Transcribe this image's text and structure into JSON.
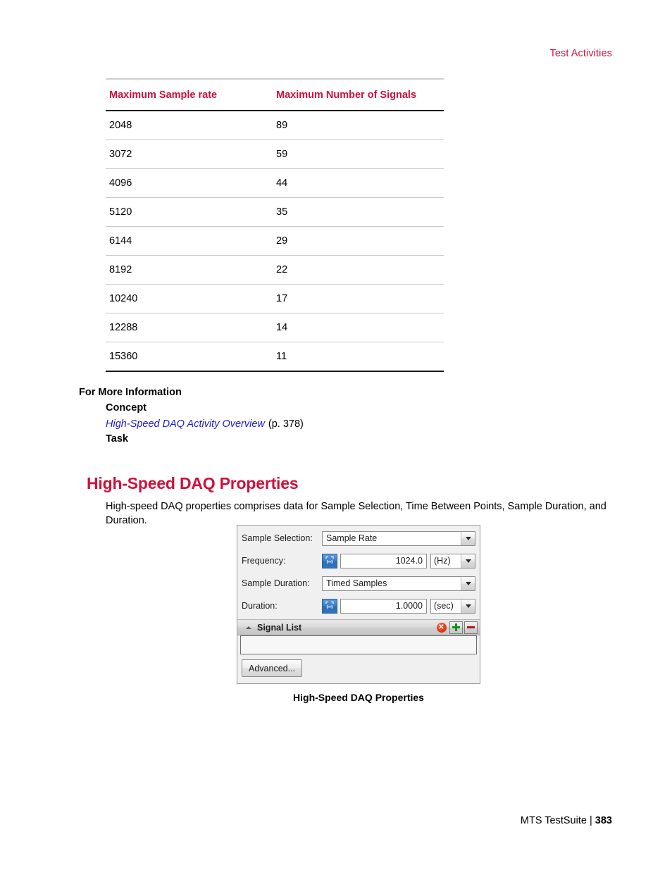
{
  "header": {
    "running_head": "Test Activities"
  },
  "spec_table": {
    "columns": [
      "Maximum Sample rate",
      "Maximum Number of Signals"
    ],
    "rows": [
      [
        "2048",
        "89"
      ],
      [
        "3072",
        "59"
      ],
      [
        "4096",
        "44"
      ],
      [
        "5120",
        "35"
      ],
      [
        "6144",
        "29"
      ],
      [
        "8192",
        "22"
      ],
      [
        "10240",
        "17"
      ],
      [
        "12288",
        "14"
      ],
      [
        "15360",
        "11"
      ]
    ]
  },
  "for_more_information": {
    "title": "For More Information",
    "concept_label": "Concept",
    "link_text": "High-Speed DAQ Activity Overview",
    "link_page": "(p. 378)",
    "task_label": "Task"
  },
  "section": {
    "heading": "High-Speed DAQ Properties",
    "body": "High-speed DAQ properties comprises data for Sample Selection, Time Between Points, Sample Duration, and Duration."
  },
  "dialog": {
    "rows": {
      "sample_selection": {
        "label": "Sample Selection:",
        "value": "Sample Rate"
      },
      "frequency": {
        "label": "Frequency:",
        "value": "1024.0",
        "unit": "(Hz)",
        "var_icon": "variable-link-icon"
      },
      "sample_duration": {
        "label": "Sample Duration:",
        "value": "Timed Samples"
      },
      "duration": {
        "label": "Duration:",
        "value": "1.0000",
        "unit": "(sec)",
        "var_icon": "variable-link-icon"
      }
    },
    "signal_list": {
      "title": "Signal List",
      "collapse_icon": "chevron-up-icon",
      "buttons": [
        {
          "name": "delete-icon",
          "glyph": "✕"
        },
        {
          "name": "add-icon",
          "glyph": "+"
        },
        {
          "name": "remove-icon",
          "glyph": "−"
        }
      ]
    },
    "advanced_button": "Advanced...",
    "caption": "High-Speed DAQ Properties"
  },
  "footer": {
    "book": "MTS TestSuite",
    "separator": "|",
    "page": "383"
  },
  "colors": {
    "accent_red": "#D0103A",
    "link_blue": "#1b1bdd",
    "button_blue": "#3a7ec4",
    "delete_red": "#e23c17",
    "add_green": "#119111",
    "remove_red": "#bb1111"
  }
}
